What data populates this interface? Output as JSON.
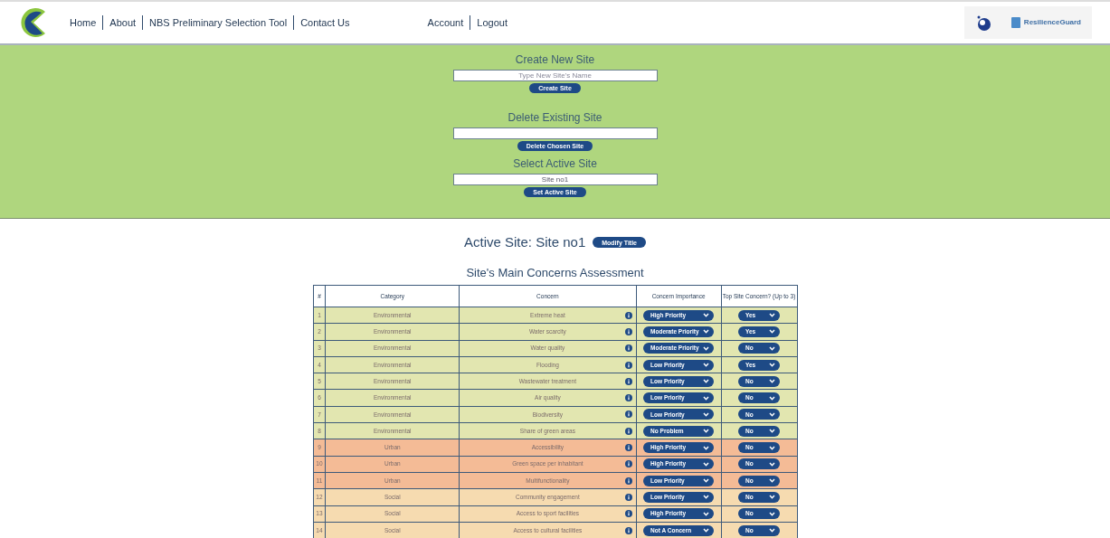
{
  "nav": {
    "links": [
      "Home",
      "About",
      "NBS Preliminary Selection Tool",
      "Contact Us"
    ],
    "account_links": [
      "Account",
      "Logout"
    ],
    "partner_logo_text": "ResilienceGuard"
  },
  "site_panel": {
    "sections": [
      {
        "title": "Create New Site",
        "placeholder": "Type New Site's Name",
        "button": "Create Site"
      },
      {
        "title": "Delete Existing Site",
        "button": "Delete Chosen Site"
      },
      {
        "title": "Select Active Site",
        "value": "Site no1",
        "button": "Set Active Site"
      }
    ]
  },
  "active_site": {
    "label": "Active Site: Site no1",
    "button": "Modify Title"
  },
  "table": {
    "title": "Site's Main Concerns Assessment",
    "columns": [
      "#",
      "Category",
      "Concern",
      "Concern Importance",
      "Top Site Concern? (Up to 3)"
    ],
    "rows": [
      {
        "num": "1",
        "category": "Environmental",
        "concern": "Extreme heat",
        "importance": "High Priority",
        "top": "Yes",
        "color": "#e2e6b0"
      },
      {
        "num": "2",
        "category": "Environmental",
        "concern": "Water scarcity",
        "importance": "Moderate Priority",
        "top": "Yes",
        "color": "#e2e6b0"
      },
      {
        "num": "3",
        "category": "Environmental",
        "concern": "Water quality",
        "importance": "Moderate Priority",
        "top": "No",
        "color": "#e2e6b0"
      },
      {
        "num": "4",
        "category": "Environmental",
        "concern": "Flooding",
        "importance": "Low Priority",
        "top": "Yes",
        "color": "#e2e6b0"
      },
      {
        "num": "5",
        "category": "Environmental",
        "concern": "Wastewater treatment",
        "importance": "Low Priority",
        "top": "No",
        "color": "#e2e6b0"
      },
      {
        "num": "6",
        "category": "Environmental",
        "concern": "Air quality",
        "importance": "Low Priority",
        "top": "No",
        "color": "#e2e6b0"
      },
      {
        "num": "7",
        "category": "Environmental",
        "concern": "Biodiversity",
        "importance": "Low Priority",
        "top": "No",
        "color": "#e2e6b0"
      },
      {
        "num": "8",
        "category": "Environmental",
        "concern": "Share of green areas",
        "importance": "No Problem",
        "top": "No",
        "color": "#e2e6b0"
      },
      {
        "num": "9",
        "category": "Urban",
        "concern": "Accessibility",
        "importance": "High Priority",
        "top": "No",
        "color": "#f4bb96"
      },
      {
        "num": "10",
        "category": "Urban",
        "concern": "Green space per inhabitant",
        "importance": "High Priority",
        "top": "No",
        "color": "#f4bb96"
      },
      {
        "num": "11",
        "category": "Urban",
        "concern": "Multifunctionality",
        "importance": "Low Priority",
        "top": "No",
        "color": "#f4bb96"
      },
      {
        "num": "12",
        "category": "Social",
        "concern": "Community engagement",
        "importance": "Low Priority",
        "top": "No",
        "color": "#f6dbb0"
      },
      {
        "num": "13",
        "category": "Social",
        "concern": "Access to sport facilities",
        "importance": "High Priority",
        "top": "No",
        "color": "#f6dbb0"
      },
      {
        "num": "14",
        "category": "Social",
        "concern": "Access to cultural facilities",
        "importance": "Not A Concern",
        "top": "No",
        "color": "#f6dbb0"
      }
    ]
  }
}
